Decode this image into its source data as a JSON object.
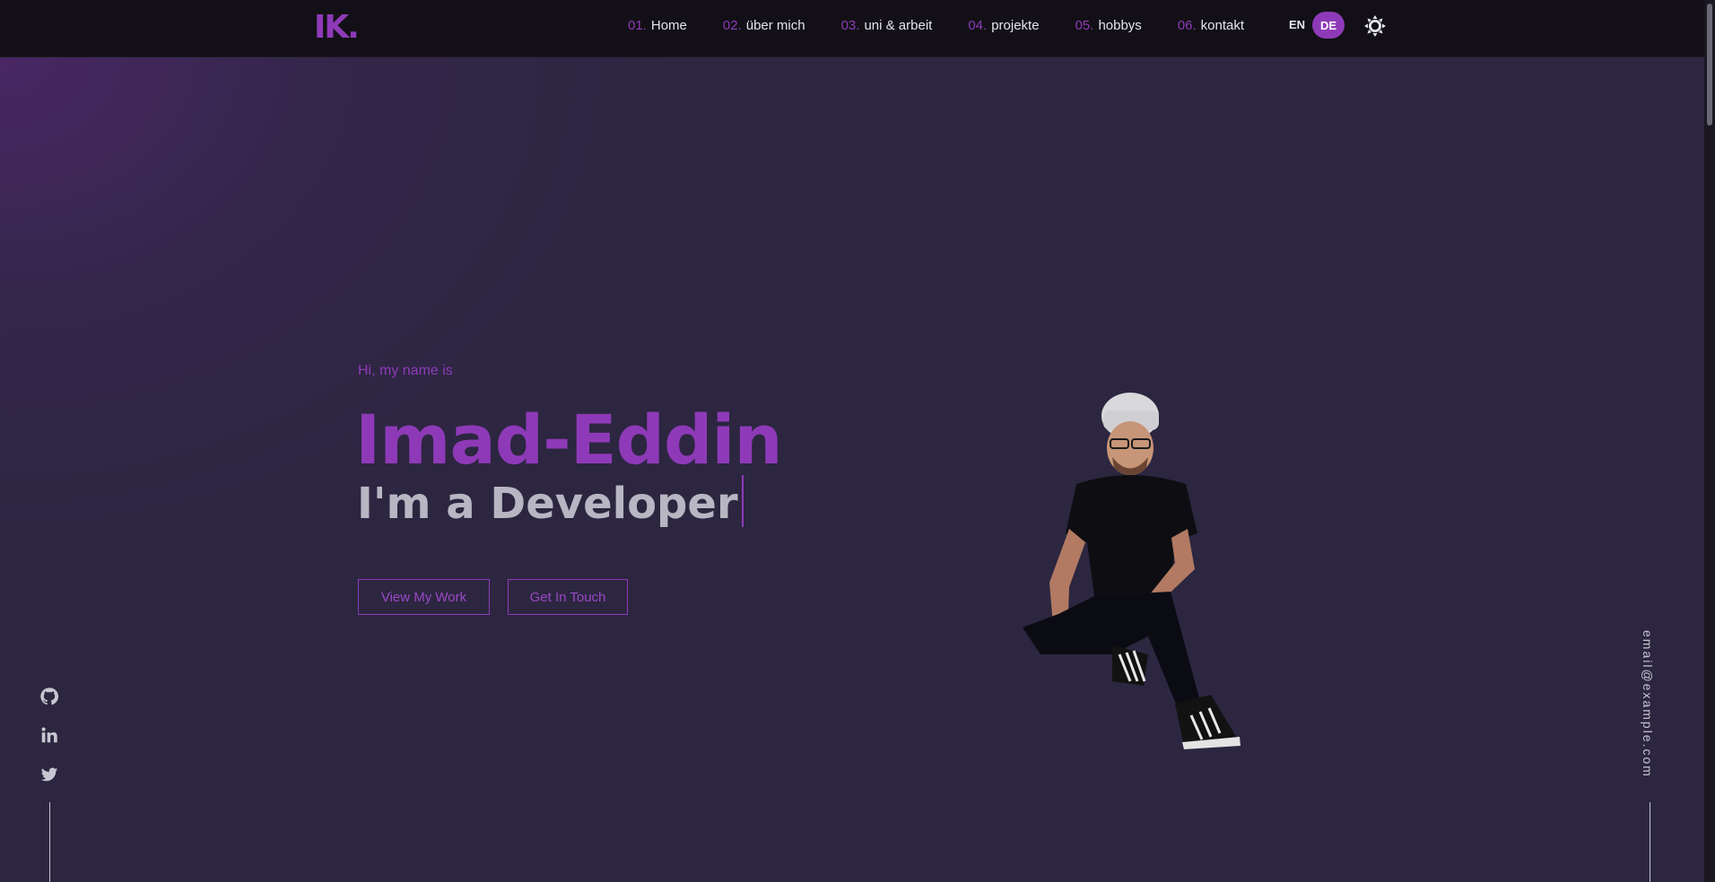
{
  "header": {
    "logo": "IK.",
    "nav": [
      {
        "num": "01.",
        "label": "Home"
      },
      {
        "num": "02.",
        "label": "über mich"
      },
      {
        "num": "03.",
        "label": "uni & arbeit"
      },
      {
        "num": "04.",
        "label": "projekte"
      },
      {
        "num": "05.",
        "label": "hobbys"
      },
      {
        "num": "06.",
        "label": "kontakt"
      }
    ],
    "lang_en": "EN",
    "lang_de": "DE",
    "theme_icon": "sun-icon"
  },
  "hero": {
    "greeting": "Hi, my name is",
    "name": "Imad-Eddin",
    "role": "I'm a Developer",
    "buttons": {
      "view_work": "View My Work",
      "get_in_touch": "Get In Touch"
    }
  },
  "social": {
    "icons": [
      "github-icon",
      "linkedin-icon",
      "twitter-icon"
    ]
  },
  "email": "email@example.com",
  "colors": {
    "accent": "#8e3ab8",
    "background": "#2c2640",
    "header": "#121016"
  }
}
